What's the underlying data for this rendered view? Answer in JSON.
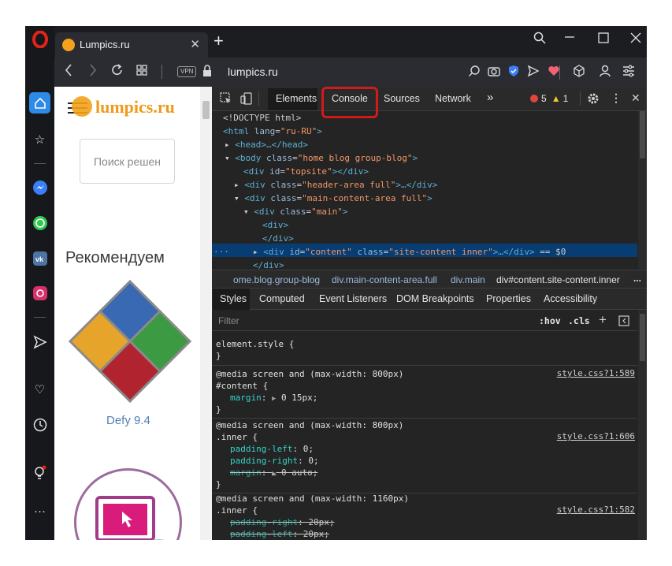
{
  "browser": {
    "tab_title": "Lumpics.ru",
    "tab_close": "✕",
    "new_tab": "+",
    "url": "lumpics.ru",
    "vpn_badge": "VPN"
  },
  "page": {
    "logo_text": "lumpics.ru",
    "search_placeholder": "Поиск решен",
    "heading": "Рекомендуем",
    "product_caption": "Defy 9.4"
  },
  "devtools": {
    "tabs": [
      "Elements",
      "Console",
      "Sources",
      "Network",
      "»"
    ],
    "error_count": "5",
    "warning_count": "1",
    "tree": [
      "<!DOCTYPE html>",
      "html_lang",
      "head",
      "body",
      "topsite",
      "header_area",
      "main_content_area",
      "main",
      "div_open",
      "div_close",
      "content",
      "div_end"
    ],
    "tree_strings": {
      "doctype": "<!DOCTYPE html>",
      "html_tag": "<html",
      "html_attr": "lang",
      "html_val": "\"ru-RU\"",
      "head": "<head>…</head>",
      "body_tag": "<body",
      "class_attr": "class",
      "body_val": "\"home blog group-blog\"",
      "div_tag": "<div",
      "id_attr": "id",
      "topsite_val": "\"topsite\"",
      "div_end_tag": "></div>",
      "header_val": "\"header-area full\"",
      "collapsed_end": ">…</div>",
      "main_content_val": "\"main-content-area full\"",
      "main_val": "\"main\"",
      "div_open": "<div>",
      "div_close": "</div>",
      "content_val": "\"content\"",
      "site_content_val": "\"site-content inner\"",
      "selected_marker": "== $0",
      "row_dots": "···",
      "gt": ">"
    },
    "breadcrumbs": [
      "ome.blog.group-blog",
      "div.main-content-area.full",
      "div.main",
      "div#content.site-content.inner",
      "..."
    ],
    "style_tabs": [
      "Styles",
      "Computed",
      "Event Listeners",
      "DOM Breakpoints",
      "Properties",
      "Accessibility"
    ],
    "filter_placeholder": "Filter",
    "hov": ":hov",
    "cls": ".cls",
    "rules": {
      "r1_sel": "element.style {",
      "r1_end": "}",
      "r2_media": "@media screen and (max-width: 800px)",
      "r2_sel": "#content {",
      "r2_prop": "margin",
      "r2_val": "0 15px;",
      "r2_src": "style.css?1:589",
      "r2_end": "}",
      "r3_media": "@media screen and (max-width: 800px)",
      "r3_sel": ".inner {",
      "r3_p1": "padding-left",
      "r3_v1": "0;",
      "r3_p2": "padding-right",
      "r3_v2": "0;",
      "r3_p3": "margin",
      "r3_v3": "0 auto;",
      "r3_src": "style.css?1:606",
      "r3_end": "}",
      "r4_media": "@media screen and (max-width: 1160px)",
      "r4_sel": ".inner {",
      "r4_p1": "padding-right",
      "r4_v1": "20px;",
      "r4_p2": "padding-left",
      "r4_v2": "20px;",
      "r4_src": "style.css?1:582",
      "r4_end": "}"
    }
  },
  "colors": {
    "highlight": "#d31a1a",
    "selected_row": "#073d72",
    "logo_orange": "#ef9a1b"
  }
}
